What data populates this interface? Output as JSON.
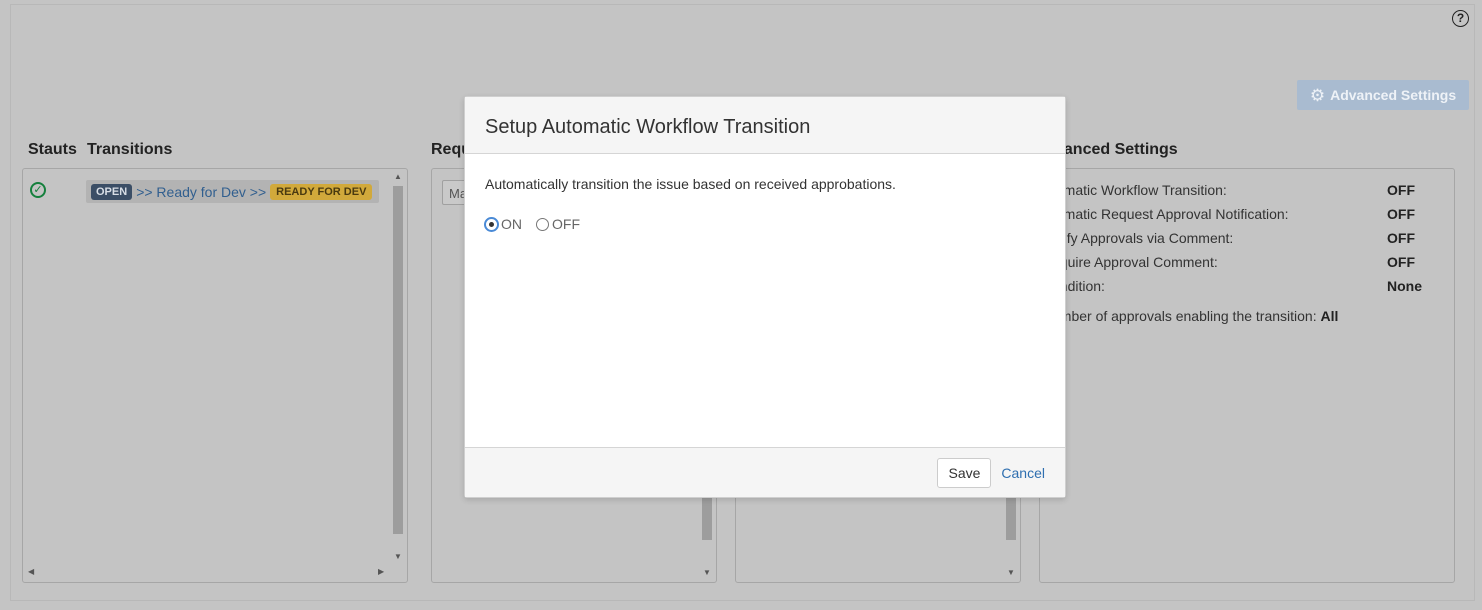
{
  "help": {
    "glyph": "?"
  },
  "toolbar": {
    "advanced_settings_label": "Advanced Settings",
    "gear_glyph": "⚙"
  },
  "columns": {
    "status": "Stauts",
    "transitions": "Transitions",
    "requests_partial": "Requ",
    "advanced_partial": "vanced Settings"
  },
  "transition": {
    "check_glyph": "✓",
    "from_status": "OPEN",
    "name": ">> Ready for Dev >>",
    "to_status": "READY FOR DEV"
  },
  "request_chip_partial": "Ma",
  "advanced": {
    "rows": [
      {
        "label": "tomatic Workflow Transition:",
        "value": "OFF"
      },
      {
        "label": "tomatic Request Approval Notification:",
        "value": "OFF"
      },
      {
        "label": "otify Approvals via Comment:",
        "value": "OFF"
      },
      {
        "label": "equire Approval Comment:",
        "value": "OFF"
      },
      {
        "label": "ondition:",
        "value": "None"
      }
    ],
    "count_label": "umber of approvals enabling the transition:",
    "count_value": "All"
  },
  "modal": {
    "title": "Setup Automatic Workflow Transition",
    "description": "Automatically transition the issue based on received approbations.",
    "options": [
      {
        "label": "ON",
        "checked": true
      },
      {
        "label": "OFF",
        "checked": false
      }
    ],
    "save_label": "Save",
    "cancel_label": "Cancel"
  },
  "scroll": {
    "up": "▲",
    "down": "▼",
    "left": "◀",
    "right": "▶"
  },
  "colors": {
    "backdrop": "#c4c4c4",
    "open_lozenge": "#3b4e66",
    "ready_lozenge": "#d1a93b",
    "link": "#2f6fb0",
    "check": "#15803d"
  }
}
